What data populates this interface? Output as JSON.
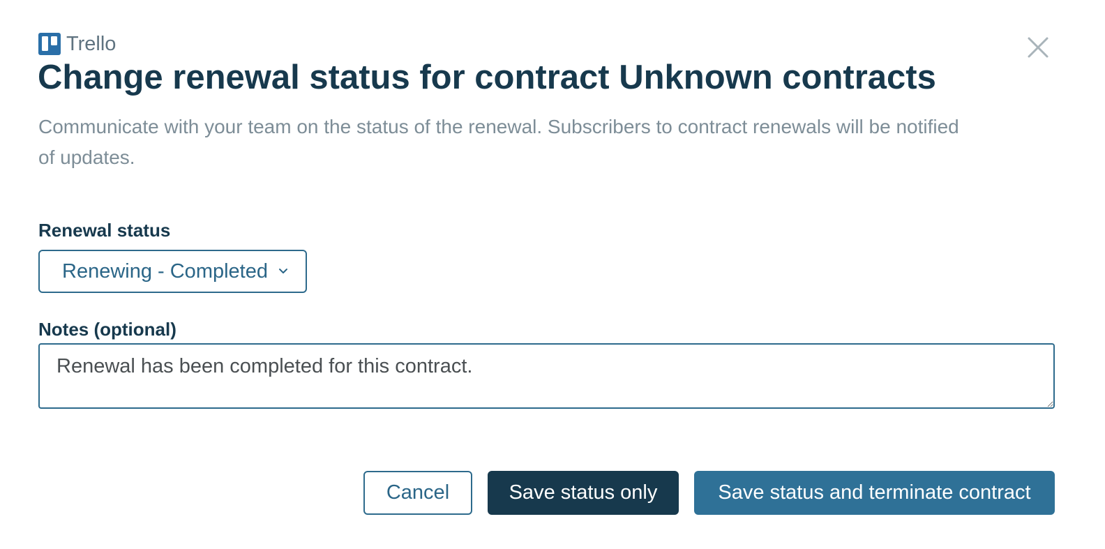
{
  "app": {
    "name": "Trello",
    "logo_icon": "trello-logo-icon",
    "brand_color": "#2a6fa8"
  },
  "dialog": {
    "close_icon": "close-icon",
    "title": "Change renewal status for contract Unknown contracts",
    "description": "Communicate with your team on the status of the renewal. Subscribers to contract renewals will be notified of updates."
  },
  "form": {
    "status_label": "Renewal status",
    "status_value": "Renewing - Completed",
    "status_icon": "chevron-down-icon",
    "notes_label": "Notes (optional)",
    "notes_value": "Renewal has been completed for this contract."
  },
  "actions": {
    "cancel_label": "Cancel",
    "save_label": "Save status only",
    "terminate_label": "Save status and terminate contract"
  },
  "colors": {
    "primary_dark": "#17394d",
    "primary": "#2f7197",
    "border": "#2d6a8c",
    "muted_text": "#7d8d97"
  }
}
